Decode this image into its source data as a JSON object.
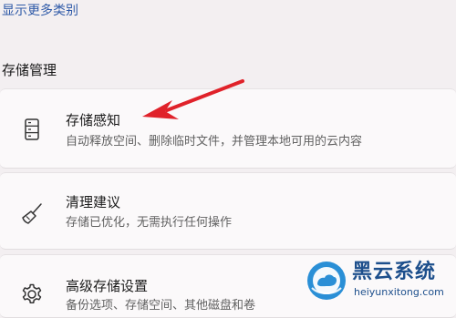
{
  "links": {
    "show_more": "显示更多类别"
  },
  "section": {
    "title": "存储管理"
  },
  "cards": [
    {
      "title": "存储感知",
      "subtitle": "自动释放空间、删除临时文件，并管理本地可用的云内容",
      "icon": "storage-drive-icon"
    },
    {
      "title": "清理建议",
      "subtitle": "存储已优化，无需执行任何操作",
      "icon": "broom-icon"
    },
    {
      "title": "高级存储设置",
      "subtitle": "备份选项、存储空间、其他磁盘和卷",
      "icon": "gear-icon"
    }
  ],
  "annotation": {
    "arrow_color": "#e0222a"
  },
  "watermark": {
    "name": "黑云系统",
    "url": "heiyunxitong.com",
    "brand_color": "#1d4f8c",
    "logo_color": "#2a8fd6"
  }
}
